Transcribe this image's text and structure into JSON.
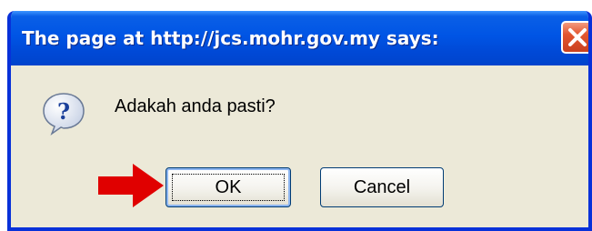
{
  "dialog": {
    "title": "The page at http://jcs.mohr.gov.my says:",
    "message": "Adakah anda pasti?",
    "ok_label": "OK",
    "cancel_label": "Cancel",
    "icon": "question-icon",
    "close_icon": "close-icon"
  },
  "annotation": {
    "icon": "arrow-right-icon",
    "color": "#e00000"
  },
  "colors": {
    "titlebar": "#0055e5",
    "frame": "#0831d9",
    "body": "#ece9d8",
    "close": "#e3562f"
  }
}
